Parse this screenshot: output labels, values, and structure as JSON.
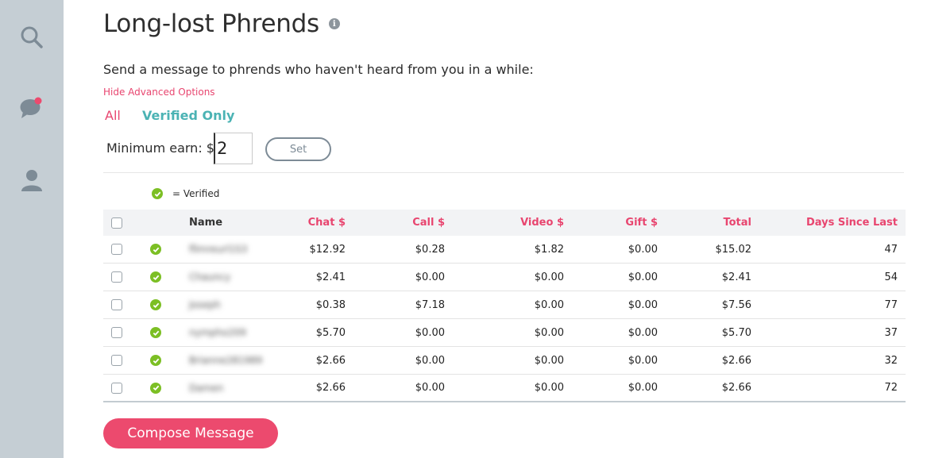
{
  "sidebar": {
    "items": [
      {
        "icon": "search-icon"
      },
      {
        "icon": "chat-bubble-icon",
        "notification": true
      },
      {
        "icon": "user-icon"
      }
    ]
  },
  "header": {
    "title": "Long-lost Phrends",
    "info_icon": "info-icon"
  },
  "subtitle": "Send a message to phrends who haven't heard from you in a while:",
  "advanced_link": "Hide Advanced Options",
  "filters": {
    "all": "All",
    "verified_only": "Verified Only"
  },
  "min_earn": {
    "label": "Minimum earn: $",
    "value": "2",
    "set_label": "Set"
  },
  "legend": {
    "text": "= Verified"
  },
  "table": {
    "headers": {
      "name": "Name",
      "chat": "Chat $",
      "call": "Call $",
      "video": "Video $",
      "gift": "Gift $",
      "total": "Total",
      "days": "Days Since Last"
    },
    "rows": [
      {
        "name": "fllmreurl1S3",
        "chat": "$12.92",
        "call": "$0.28",
        "video": "$1.82",
        "gift": "$0.00",
        "total": "$15.02",
        "days": "47"
      },
      {
        "name": "Chauncy",
        "chat": "$2.41",
        "call": "$0.00",
        "video": "$0.00",
        "gift": "$0.00",
        "total": "$2.41",
        "days": "54"
      },
      {
        "name": "Joseph",
        "chat": "$0.38",
        "call": "$7.18",
        "video": "$0.00",
        "gift": "$0.00",
        "total": "$7.56",
        "days": "77"
      },
      {
        "name": "nympho209",
        "chat": "$5.70",
        "call": "$0.00",
        "video": "$0.00",
        "gift": "$0.00",
        "total": "$5.70",
        "days": "37"
      },
      {
        "name": "Brianne281989",
        "chat": "$2.66",
        "call": "$0.00",
        "video": "$0.00",
        "gift": "$0.00",
        "total": "$2.66",
        "days": "32"
      },
      {
        "name": "Damen",
        "chat": "$2.66",
        "call": "$0.00",
        "video": "$0.00",
        "gift": "$0.00",
        "total": "$2.66",
        "days": "72"
      }
    ]
  },
  "compose_button": "Compose Message",
  "colors": {
    "accent": "#e8456f",
    "teal": "#4bb3b4",
    "verified": "#7cbf24",
    "sidebar": "#c5ced4"
  }
}
